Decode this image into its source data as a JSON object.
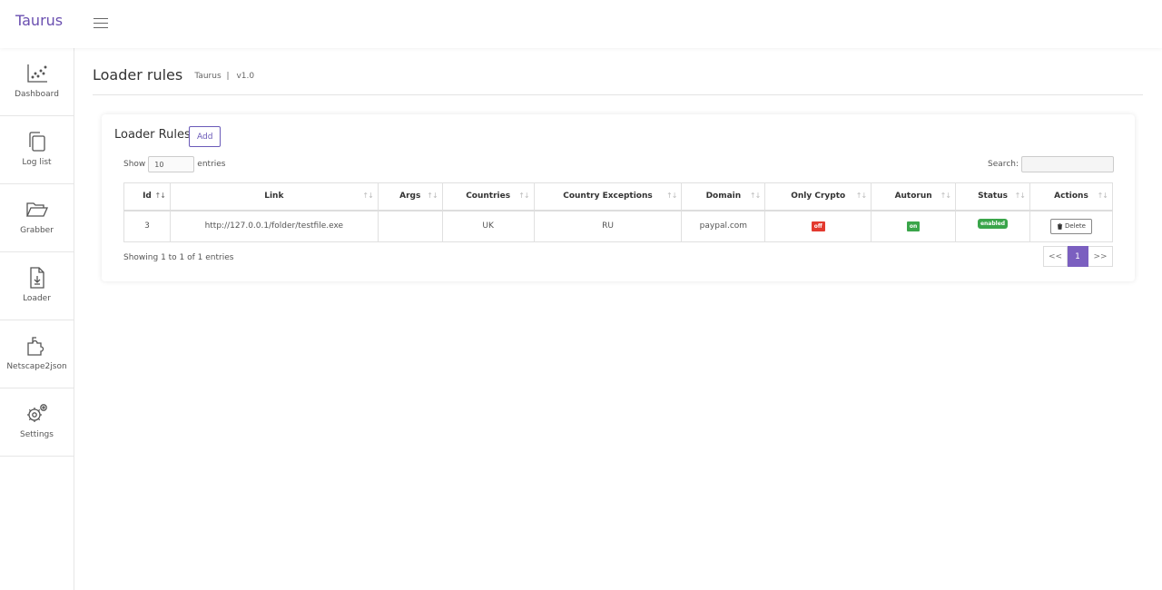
{
  "app": {
    "brand": "Taurus"
  },
  "sidebar": {
    "items": [
      {
        "label": "Dashboard",
        "icon": "chart-icon"
      },
      {
        "label": "Log list",
        "icon": "copy-icon"
      },
      {
        "label": "Grabber",
        "icon": "folder-open-icon"
      },
      {
        "label": "Loader",
        "icon": "file-download-icon"
      },
      {
        "label": "Netscape2json",
        "icon": "puzzle-icon"
      },
      {
        "label": "Settings",
        "icon": "gears-icon"
      }
    ]
  },
  "page": {
    "title": "Loader rules",
    "breadcrumb": {
      "app": "Taurus",
      "separator": "|",
      "version": "v1.0"
    }
  },
  "card": {
    "title": "Loader Rules",
    "add_label": "Add",
    "show_label": "Show",
    "show_value": "10",
    "entries_label": "entries",
    "search_label": "Search:",
    "info": "Showing 1 to 1 of 1 entries",
    "pager": {
      "prev": "<<",
      "current": "1",
      "next": ">>"
    }
  },
  "table": {
    "columns": [
      "Id",
      "Link",
      "Args",
      "Countries",
      "Country Exceptions",
      "Domain",
      "Only Crypto",
      "Autorun",
      "Status",
      "Actions"
    ],
    "rows": [
      {
        "id": "3",
        "link": "http://127.0.0.1/folder/testfile.exe",
        "args": "",
        "countries": "UK",
        "country_exceptions": "RU",
        "domain": "paypal.com",
        "only_crypto": "off",
        "autorun": "on",
        "status": "enabled",
        "action": "Delete"
      }
    ]
  },
  "colors": {
    "accent": "#7b5fc0",
    "brand": "#6a4fb0",
    "off": "#e33a2f",
    "on": "#3aa54a"
  }
}
